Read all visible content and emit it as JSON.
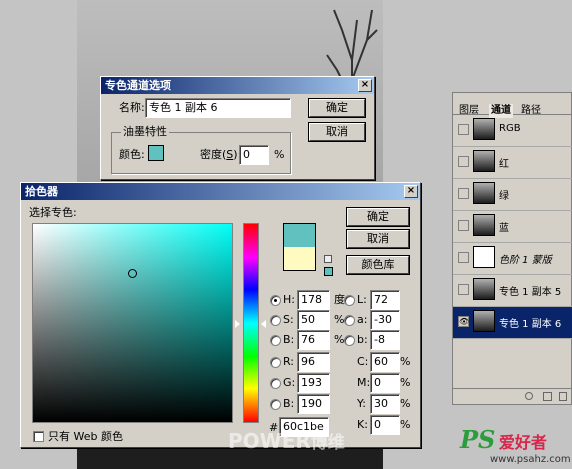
{
  "spot_dialog": {
    "title": "专色通道选项",
    "close": "×",
    "name_label": "名称:",
    "name_value": "专色 1 副本 6",
    "ok": "确定",
    "cancel": "取消",
    "ink_group": "油墨特性",
    "color_label": "颜色:",
    "color_value": "#60c1be",
    "solidity_label_pre": "密度(",
    "solidity_label_key": "S",
    "solidity_label_post": "):",
    "solidity_value": "0",
    "solidity_unit": "%"
  },
  "picker": {
    "title": "拾色器",
    "close": "×",
    "subtitle": "选择专色:",
    "ok": "确定",
    "cancel": "取消",
    "library": "颜色库",
    "new_color": "#60c1be",
    "old_color": "#fefac0",
    "web_only_label": "只有 Web 颜色",
    "hex_symbol": "#",
    "hex_value": "60c1be",
    "fields": {
      "H": {
        "label": "H:",
        "value": "178",
        "unit": "度"
      },
      "S": {
        "label": "S:",
        "value": "50",
        "unit": "%"
      },
      "B": {
        "label": "B:",
        "value": "76",
        "unit": "%"
      },
      "R": {
        "label": "R:",
        "value": "96"
      },
      "G": {
        "label": "G:",
        "value": "193"
      },
      "Bl": {
        "label": "B:",
        "value": "190"
      },
      "L": {
        "label": "L:",
        "value": "72"
      },
      "a": {
        "label": "a:",
        "value": "-30"
      },
      "b": {
        "label": "b:",
        "value": "-8"
      },
      "C": {
        "label": "C:",
        "value": "60",
        "unit": "%"
      },
      "M": {
        "label": "M:",
        "value": "0",
        "unit": "%"
      },
      "Y": {
        "label": "Y:",
        "value": "30",
        "unit": "%"
      },
      "K": {
        "label": "K:",
        "value": "0",
        "unit": "%"
      }
    }
  },
  "layers": {
    "tabs": [
      "图层",
      "通道",
      "路径"
    ],
    "items": [
      {
        "label": "RGB",
        "italic": false
      },
      {
        "label": "红",
        "italic": false
      },
      {
        "label": "绿",
        "italic": false
      },
      {
        "label": "蓝",
        "italic": false
      },
      {
        "label": "色阶 1 蒙版",
        "italic": true
      },
      {
        "label": "专色 1 副本 5",
        "italic": false
      },
      {
        "label": "专色 1 副本 6",
        "italic": false
      }
    ]
  },
  "watermark": {
    "power": "POWER",
    "suffix": "博维",
    "ps": "PS",
    "site_cn": "爱好者",
    "url": "www.psahz.com"
  }
}
